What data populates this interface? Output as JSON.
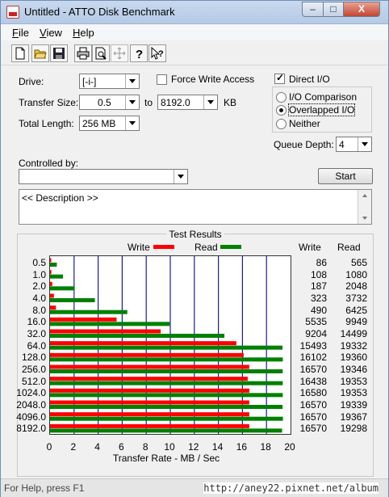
{
  "window": {
    "title": "Untitled - ATTO Disk Benchmark"
  },
  "titlebar": {
    "min": "–",
    "max": "□",
    "close": "X"
  },
  "menu": {
    "file": {
      "label": "File",
      "u": "F",
      "rest": "ile"
    },
    "view": {
      "label": "View",
      "u": "V",
      "rest": "iew"
    },
    "help": {
      "label": "Help",
      "u": "H",
      "rest": "elp"
    }
  },
  "toolbar": {
    "icons": [
      "new-icon",
      "open-icon",
      "save-icon",
      "print-icon",
      "print-preview-icon",
      "move-icon",
      "help-icon",
      "context-help-icon"
    ]
  },
  "form": {
    "drive_label": "Drive:",
    "drive_value": "[-i-]",
    "force_write_label": "Force Write Access",
    "direct_io_label": "Direct I/O",
    "transfer_size_label": "Transfer Size:",
    "transfer_from": "0.5",
    "to_label": "to",
    "transfer_to": "8192.0",
    "kb_label": "KB",
    "total_length_label": "Total Length:",
    "total_length_value": "256 MB",
    "io_comparison_label": "I/O Comparison",
    "overlapped_io_label": "Overlapped I/O",
    "neither_label": "Neither",
    "queue_depth_label": "Queue Depth:",
    "queue_depth_value": "4",
    "controlled_by_label": "Controlled by:",
    "controlled_by_value": "",
    "start_label": "Start",
    "description": "<< Description >>"
  },
  "state": {
    "force_write": false,
    "direct_io": true,
    "io_mode": "overlapped"
  },
  "results": {
    "title": "Test Results",
    "legend_write": "Write",
    "legend_read": "Read",
    "col_write": "Write",
    "col_read": "Read",
    "xlabel": "Transfer Rate - MB / Sec",
    "colors": {
      "write": "#ff0000",
      "read": "#008000",
      "grid": "#1a1aa6"
    }
  },
  "chart_data": {
    "type": "bar",
    "orientation": "horizontal",
    "categories": [
      "0.5",
      "1.0",
      "2.0",
      "4.0",
      "8.0",
      "16.0",
      "32.0",
      "64.0",
      "128.0",
      "256.0",
      "512.0",
      "1024.0",
      "2048.0",
      "4096.0",
      "8192.0"
    ],
    "series": [
      {
        "name": "Write",
        "values": [
          86,
          108,
          187,
          323,
          490,
          5535,
          9204,
          15493,
          16102,
          16570,
          16438,
          16580,
          16570,
          16570,
          16570
        ]
      },
      {
        "name": "Read",
        "values": [
          565,
          1080,
          2048,
          3732,
          6425,
          9949,
          14499,
          19332,
          19360,
          19346,
          19353,
          19353,
          19339,
          19367,
          19298
        ]
      }
    ],
    "write_display": [
      "86",
      "108",
      "187",
      "323",
      "490",
      "5535",
      "9204",
      "15493",
      "16102",
      "16570",
      "16438",
      "16580",
      "16570",
      "16570",
      "16570"
    ],
    "read_display": [
      "565",
      "1080",
      "2048",
      "3732",
      "6425",
      "9949",
      "14499",
      "19332",
      "19360",
      "19346",
      "19353",
      "19353",
      "19339",
      "19367",
      "19298"
    ],
    "xticks": [
      "0",
      "2",
      "4",
      "6",
      "8",
      "10",
      "12",
      "14",
      "16",
      "18",
      "20"
    ],
    "xlim": [
      0,
      20
    ],
    "grid": true,
    "xlabel": "Transfer Rate - MB / Sec"
  },
  "statusbar": {
    "text": "For Help, press F1"
  },
  "watermark": "http://aney22.pixnet.net/album"
}
